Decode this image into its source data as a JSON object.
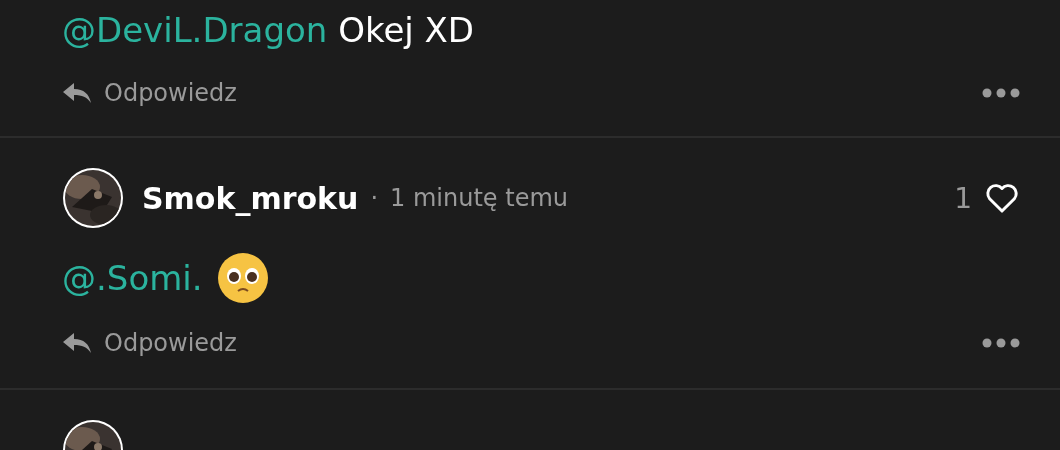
{
  "comments": [
    {
      "kind": "cut",
      "mention": "@DeviL.Dragon",
      "text": "Okej XD",
      "reply": "Odpowiedz"
    },
    {
      "kind": "full",
      "author": "Smok_mroku",
      "separator": "·",
      "time": "1 minutę temu",
      "likes": "1",
      "liked": false,
      "mention": "@.Somi.",
      "reply": "Odpowiedz"
    },
    {
      "kind": "avatar_only"
    }
  ]
}
